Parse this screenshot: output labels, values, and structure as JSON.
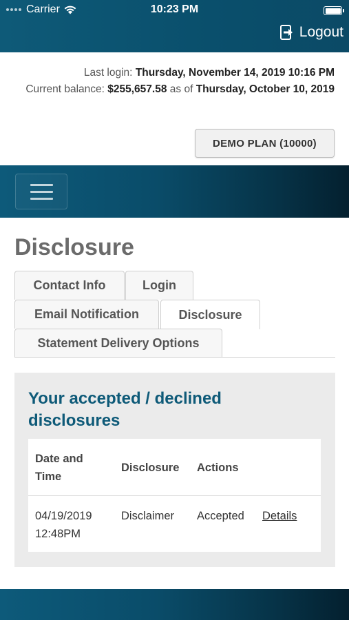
{
  "status_bar": {
    "carrier": "Carrier",
    "time": "10:23 PM"
  },
  "header": {
    "logout_label": "Logout"
  },
  "account": {
    "last_login_label": "Last login:",
    "last_login_value": "Thursday, November 14, 2019 10:16 PM",
    "balance_label": "Current balance:",
    "balance_value": "$255,657.58",
    "as_of_label": "as of",
    "as_of_value": "Thursday, October 10, 2019",
    "plan_button": "DEMO PLAN (10000)"
  },
  "page": {
    "title": "Disclosure"
  },
  "tabs": [
    {
      "label": "Contact Info"
    },
    {
      "label": "Login"
    },
    {
      "label": "Email Notification"
    },
    {
      "label": "Disclosure"
    },
    {
      "label": "Statement Delivery Options"
    }
  ],
  "disclosures": {
    "heading": "Your accepted / declined disclosures",
    "columns": [
      "Date and Time",
      "Disclosure",
      "Actions"
    ],
    "rows": [
      {
        "date": "04/19/2019",
        "time": "12:48PM",
        "disclosure": "Disclaimer",
        "status": "Accepted",
        "action": "Details"
      }
    ]
  }
}
